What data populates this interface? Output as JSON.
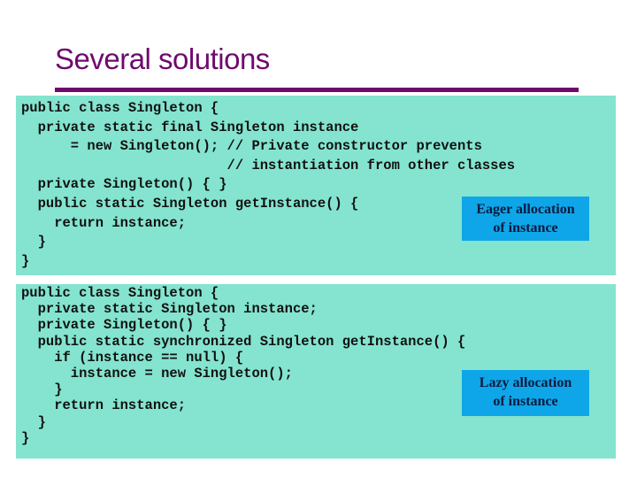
{
  "slide": {
    "title": "Several solutions",
    "colors": {
      "title": "#6e0a6e",
      "code_background": "#84e4cf",
      "callout_background": "#0ea6e8"
    }
  },
  "examples": [
    {
      "label": "eager",
      "code_lines": [
        "public class Singleton {",
        "  private static final Singleton instance",
        "      = new Singleton(); // Private constructor prevents",
        "                         // instantiation from other classes",
        "  private Singleton() { }",
        "  public static Singleton getInstance() {",
        "    return instance;",
        "  }",
        "}"
      ],
      "callout": [
        "Eager allocation",
        "of instance"
      ]
    },
    {
      "label": "lazy",
      "code_lines": [
        "public class Singleton {",
        "  private static Singleton instance;",
        "  private Singleton() { }",
        "  public static synchronized Singleton getInstance() {",
        "    if (instance == null) {",
        "      instance = new Singleton();",
        "    }",
        "    return instance;",
        "  }",
        "}"
      ],
      "callout": [
        "Lazy allocation",
        "of instance"
      ]
    }
  ]
}
